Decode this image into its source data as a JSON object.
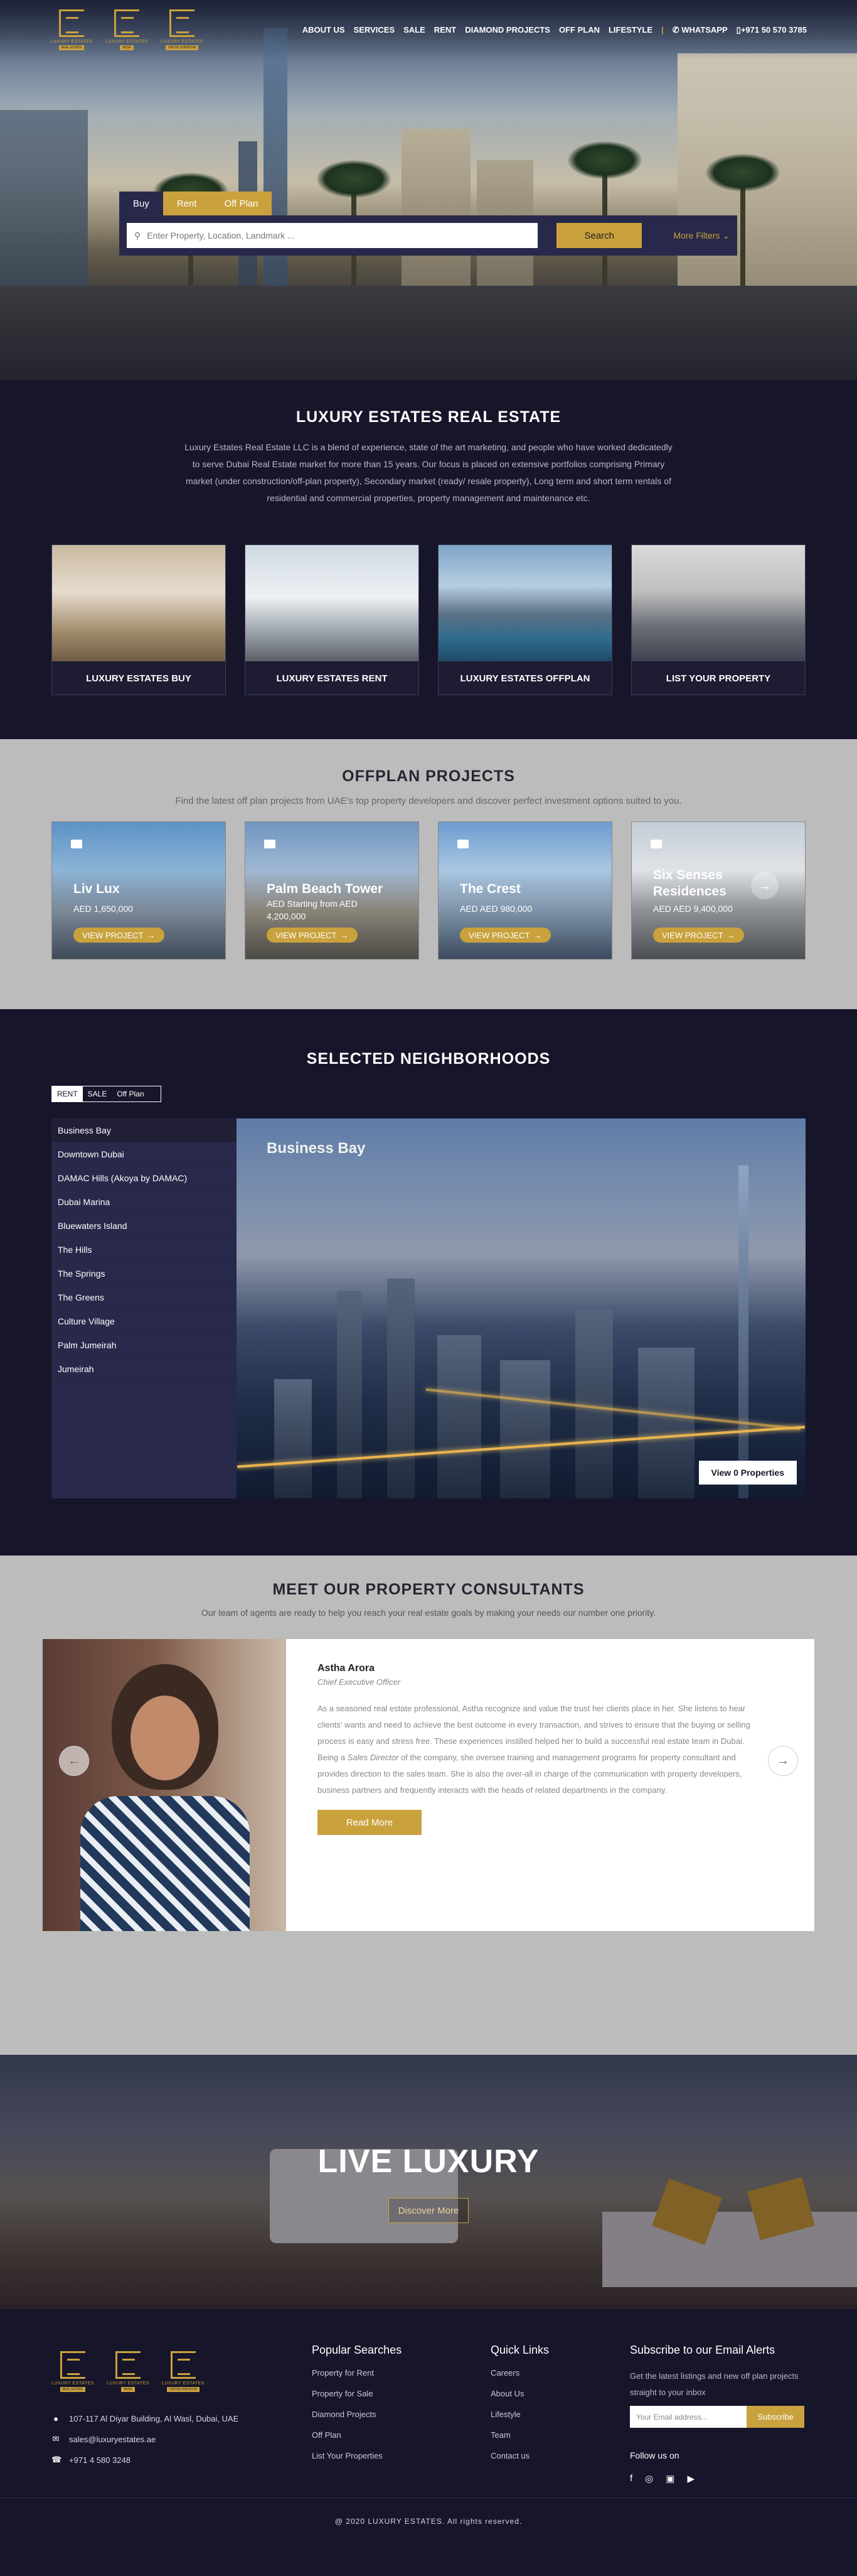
{
  "header": {
    "logos": [
      {
        "text": "LUXURY ESTATES",
        "sub": "REAL ESTATE"
      },
      {
        "text": "LUXURY ESTATES",
        "sub": "INDIA"
      },
      {
        "text": "LUXURY ESTATES",
        "sub": "UNITED KINGDOM"
      }
    ],
    "nav": [
      "ABOUT US",
      "SERVICES",
      "SALE",
      "RENT",
      "DIAMOND PROJECTS",
      "OFF PLAN",
      "LIFESTYLE"
    ],
    "separator": "|",
    "whatsapp": "WHATSAPP",
    "phone": "+971 50 570 3785"
  },
  "search": {
    "tabs": [
      "Buy",
      "Rent",
      "Off Plan"
    ],
    "placeholder": "Enter Property, Location, Landmark ...",
    "button": "Search",
    "more_filters": "More Filters"
  },
  "about": {
    "title": "LUXURY ESTATES REAL ESTATE",
    "text": "Luxury Estates Real Estate LLC is a blend of experience, state of the art marketing, and people who have worked dedicatedly to serve Dubai Real Estate market for more than 15 years. Our focus is placed on extensive portfolios comprising Primary market (under construction/off-plan property), Secondary market (ready/ resale property), Long term and short term rentals of residential and commercial properties, property management and maintenance etc.",
    "cards": [
      "LUXURY ESTATES BUY",
      "LUXURY ESTATES RENT",
      "LUXURY ESTATES OFFPLAN",
      "LIST YOUR PROPERTY"
    ]
  },
  "offplan": {
    "title": "OFFPLAN PROJECTS",
    "lead": "Find the latest off plan projects from UAE's top property developers and discover perfect investment options suited to you.",
    "cards": [
      {
        "name": "Liv Lux",
        "price1": "AED 1,650,000",
        "price2": ""
      },
      {
        "name": "Palm Beach Tower",
        "price1": "AED Starting from AED",
        "price2": "4,200,000"
      },
      {
        "name": "The Crest",
        "price1": "AED AED 980,000",
        "price2": ""
      },
      {
        "name": "Six Senses Residences",
        "price1": "AED AED 9,400,000",
        "price2": ""
      }
    ],
    "view_label": "VIEW PROJECT"
  },
  "neighborhoods": {
    "title": "SELECTED NEIGHBORHOODS",
    "tabs": [
      "RENT",
      "SALE",
      "Off Plan"
    ],
    "list": [
      "Business Bay",
      "Downtown Dubai",
      "DAMAC Hills (Akoya by DAMAC)",
      "Dubai Marina",
      "Bluewaters Island",
      "The Hills",
      "The Springs",
      "The Greens",
      "Culture Village",
      "Palm Jumeirah",
      "Jumeirah"
    ],
    "selected_title": "Business Bay",
    "view_button": "View 0 Properties"
  },
  "consultants": {
    "title": "MEET OUR PROPERTY CONSULTANTS",
    "lead": "Our team of agents are ready to help you reach your real estate goals by making your needs our number one priority.",
    "name": "Astha Arora",
    "role": "Chief Executive Officer",
    "bio_a": "As a seasoned real estate professional, Astha recognize and value the trust her clients place in her. She listens to hear clients' wants and need to achieve the best outcome in every transaction, and strives to ensure that the buying or selling process is easy and stress free. These experiences instilled helped her to build a successful real estate team in Dubai. Being a ",
    "bio_em": "Sales Director",
    "bio_b": " of the company, she oversee training and management programs for property consultant and provides direction to the sales team. She is also the over-all in charge of the communication with property developers, business partners and frequently interacts with the heads of related departments in the company.",
    "read_more": "Read More"
  },
  "live": {
    "title": "LIVE LUXURY",
    "button": "Discover More"
  },
  "footer": {
    "address": "107-117 Al Diyar Building, Al Wasl, Dubai, UAE",
    "email": "sales@luxuryestates.ae",
    "phone": "+971 4 580 3248",
    "popular_title": "Popular Searches",
    "popular": [
      "Property for Rent",
      "Property for Sale",
      "Diamond Projects",
      "Off Plan",
      "List Your Properties"
    ],
    "quick_title": "Quick Links",
    "quick": [
      "Careers",
      "About Us",
      "Lifestyle",
      "Team",
      "Contact us"
    ],
    "subscribe_title": "Subscribe to our Email Alerts",
    "subscribe_text": "Get the latest listings and new off plan projects straight to your inbox",
    "email_placeholder": "Your Email address...",
    "subscribe_button": "Subscribe",
    "follow": "Follow us on",
    "social": [
      "facebook-icon",
      "instagram-icon",
      "linkedin-icon",
      "youtube-icon"
    ],
    "copyright": "@ 2020 LUXURY ESTATES. All rights reserved."
  },
  "colors": {
    "accent": "#c9a23d",
    "dark": "#16152a",
    "panel": "#28294a",
    "grey": "#bcbcbc"
  }
}
